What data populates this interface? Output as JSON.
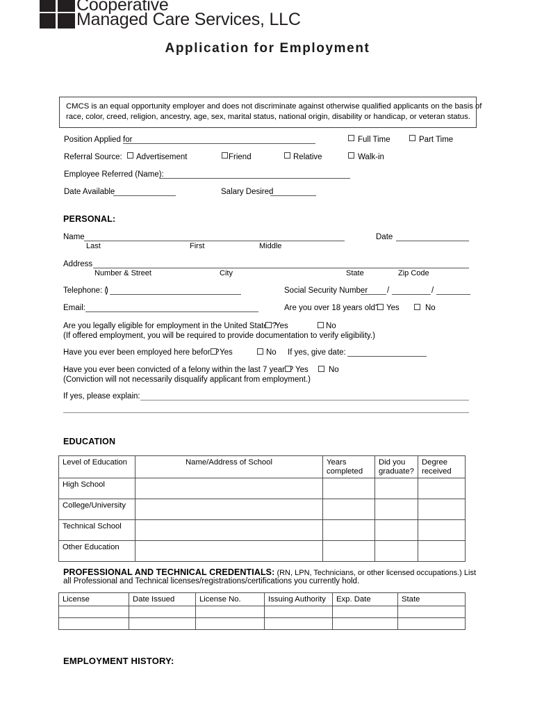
{
  "company": {
    "logo_name": "cmcs-logo",
    "name_line1": "Cooperative",
    "name_line2": "Managed Care Services, LLC"
  },
  "document": {
    "title": "Application for Employment"
  },
  "eeo_notice": {
    "line1": "CMCS is an equal opportunity employer and does not discriminate against otherwise qualified applicants on the basis of",
    "line2": "race, color, creed, religion, ancestry, age, sex, marital status, national origin, disability or handicap, or veteran status."
  },
  "position_section": {
    "position_applied_for_label": "Position Applied for",
    "full_time_label": "Full Time",
    "part_time_label": "Part Time",
    "referral_source_label": "Referral Source:",
    "advertisement_label": "Advertisement",
    "friend_label": "Friend",
    "relative_label": "Relative",
    "walk_in_label": "Walk-in",
    "employee_referred_label": "Employee Referred (Name):",
    "date_available_label": "Date Available",
    "salary_desired_label": "Salary Desired"
  },
  "personal_section": {
    "heading": "PERSONAL:",
    "name_label": "Name",
    "date_label": "Date",
    "last_label": "Last",
    "first_label": "First",
    "middle_label": "Middle",
    "address_label": "Address",
    "number_street_label": "Number & Street",
    "city_label": "City",
    "state_label": "State",
    "zip_code_label": "Zip Code",
    "telephone_label": "Telephone: (",
    "telephone_paren_close": ")",
    "ssn_label": "Social Security Number",
    "ssn_slash_1": "/",
    "ssn_slash_2": "/",
    "email_label": "Email:",
    "over_18_label": "Are you over 18 years old?",
    "over_18_yes": "Yes",
    "over_18_no": "No",
    "eligible_label": "Are you legally eligible for employment in the United States?",
    "eligible_yes": "Yes",
    "eligible_no": "No",
    "eligible_note": "(If offered employment, you will be required to provide documentation to verify eligibility.)",
    "employed_before_label": "Have you ever been employed here before?",
    "employed_before_yes": "Yes",
    "employed_before_no": "No",
    "employed_before_date_label": "If yes, give date:",
    "felony_label": "Have you ever been convicted of a felony within the last 7 years?",
    "felony_yes": "Yes",
    "felony_no": "No",
    "felony_note": "(Conviction will not necessarily disqualify applicant from employment.)",
    "explain_label": "If yes, please explain:"
  },
  "education_section": {
    "heading": "EDUCATION",
    "columns": [
      "Level of Education",
      "Name/Address of School",
      "Years completed",
      "Did you graduate?",
      "Degree received"
    ],
    "column_lines": [
      [
        "Level of Education"
      ],
      [
        "Name/Address of School"
      ],
      [
        "Years",
        "completed"
      ],
      [
        "Did you",
        "graduate?"
      ],
      [
        "Degree",
        "received"
      ]
    ],
    "rows": [
      {
        "level": "High School",
        "school": "",
        "years": "",
        "graduate": "",
        "degree": ""
      },
      {
        "level": "College/University",
        "school": "",
        "years": "",
        "graduate": "",
        "degree": ""
      },
      {
        "level": "Technical School",
        "school": "",
        "years": "",
        "graduate": "",
        "degree": ""
      },
      {
        "level": "Other Education",
        "school": "",
        "years": "",
        "graduate": "",
        "degree": ""
      }
    ]
  },
  "credentials_section": {
    "heading": "PROFESSIONAL AND TECHNICAL CREDENTIALS:",
    "heading_note": "(RN, LPN, Technicians, or other licensed occupations.)  List",
    "subtext": "all Professional and Technical licenses/registrations/certifications you currently hold.",
    "columns": [
      "License",
      "Date Issued",
      "License No.",
      "Issuing Authority",
      "Exp. Date",
      "State"
    ],
    "rows": [
      {
        "license": "",
        "date_issued": "",
        "license_no": "",
        "issuing_authority": "",
        "exp_date": "",
        "state": ""
      },
      {
        "license": "",
        "date_issued": "",
        "license_no": "",
        "issuing_authority": "",
        "exp_date": "",
        "state": ""
      }
    ]
  },
  "employment_history_section": {
    "heading": "EMPLOYMENT HISTORY:"
  },
  "colors": {
    "ink": "#000000",
    "logo": "#231f20",
    "rule": "#555555",
    "table_border": "#4a4a4a"
  }
}
